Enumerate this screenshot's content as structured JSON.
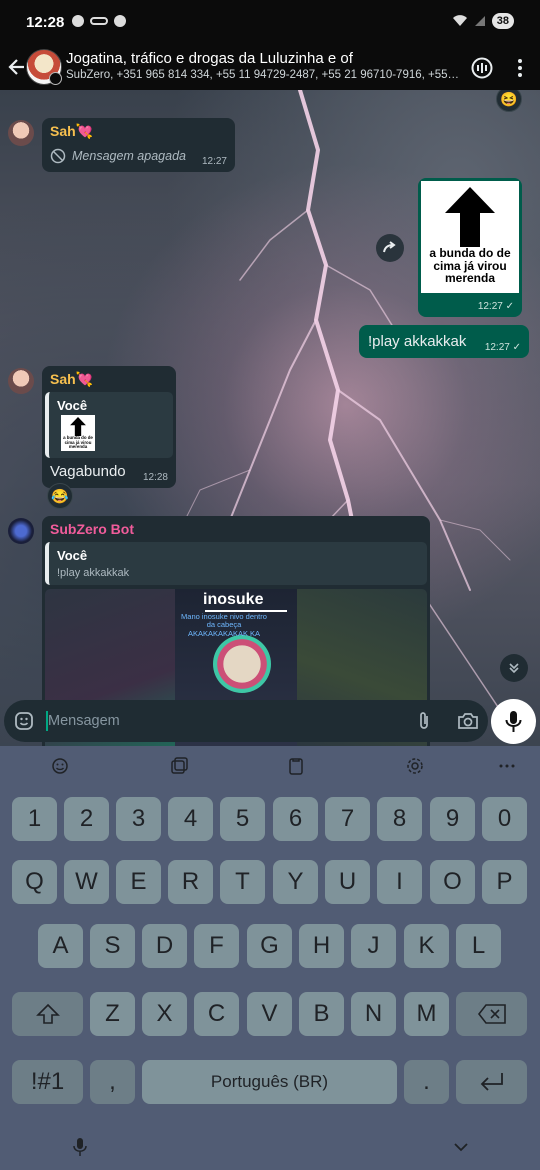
{
  "status_bar": {
    "time": "12:28",
    "battery": "38"
  },
  "header": {
    "title": "Jogatina, tráfico e drogas da Luluzinha e of",
    "members": "SubZero, +351 965 814 334, +55 11 94729-2487, +55 21 96710-7916, +55 21 9..."
  },
  "messages": {
    "m1": {
      "sender": "Sah💘",
      "deleted_text": "Mensagem apagada",
      "time": "12:27",
      "reaction_top": "😆"
    },
    "m2": {
      "image_caption": "a bunda do de cima já virou merenda",
      "time": "12:27 ✓"
    },
    "m3": {
      "text": "!play akkakkak",
      "time": "12:27 ✓"
    },
    "m4": {
      "sender": "Sah💘",
      "quote_name": "Você",
      "quote_image_caption": "a bunda do de cima já virou merenda",
      "text": "Vagabundo",
      "time": "12:28",
      "reaction": "😂"
    },
    "m5": {
      "sender": "SubZero Bot",
      "quote_name": "Você",
      "quote_text": "!play akkakkak",
      "video_title": "inosuke",
      "video_overlay": "Mano inosuke nivo dentro da cabeça AKAKAKAKAKAK KA"
    }
  },
  "composer": {
    "placeholder": "Mensagem"
  },
  "keyboard": {
    "row_numbers": [
      "1",
      "2",
      "3",
      "4",
      "5",
      "6",
      "7",
      "8",
      "9",
      "0"
    ],
    "row_q": [
      "Q",
      "W",
      "E",
      "R",
      "T",
      "Y",
      "U",
      "I",
      "O",
      "P"
    ],
    "row_a": [
      "A",
      "S",
      "D",
      "F",
      "G",
      "H",
      "J",
      "K",
      "L"
    ],
    "row_z": [
      "Z",
      "X",
      "C",
      "V",
      "B",
      "N",
      "M"
    ],
    "symbols": "!#1",
    "comma": ",",
    "space": "Português (BR)",
    "period": "."
  },
  "colors": {
    "sender_sah": "#f7c04f",
    "sender_bot": "#f15c9b",
    "bubble_in": "#202c33",
    "bubble_out": "#005c4b",
    "accent": "#00a884"
  },
  "icons": [
    "back-arrow-icon",
    "voice-chat-icon",
    "more-options-icon",
    "deleted-icon",
    "forward-icon",
    "scroll-down-icon",
    "sticker-icon",
    "attach-icon",
    "camera-icon",
    "mic-icon",
    "emoji-icon",
    "clipboard-icon",
    "settings-icon",
    "shift-icon",
    "backspace-icon",
    "enter-icon"
  ]
}
